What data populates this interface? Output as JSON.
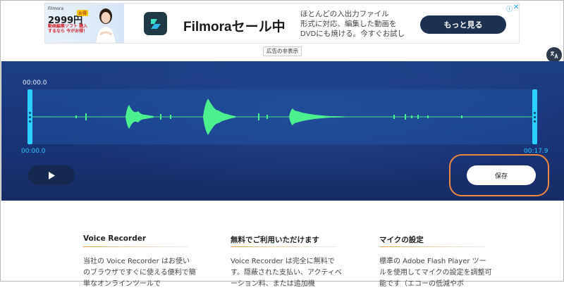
{
  "ad": {
    "thumb": {
      "brand": "Filmora",
      "price": "2999円",
      "tag": "お得",
      "copy": "動画編集ソフト 購入するなら 今がお得！"
    },
    "title": "Filmoraセール中",
    "description_lines": [
      "ほとんどの入出力ファイル",
      "形式に対応、編集した動画を",
      "DVDにも焼ける。今すぐお試し"
    ],
    "cta": "もっと見る",
    "info_icon": "ⓘ",
    "close_icon": "✕",
    "hide_label": "広告の非表示"
  },
  "side": {
    "translate_icon": "translate-icon",
    "extension_icon": "extension-icon"
  },
  "recorder": {
    "time_current": "00:00.0",
    "time_start": "00:00.0",
    "time_end": "00:17.9",
    "play_icon": "play-icon",
    "save_label": "保存",
    "accent_color": "#2ad1ff",
    "highlight_color": "#f0873c"
  },
  "info": {
    "columns": [
      {
        "title": "Voice Recorder",
        "text": "当社の Voice Recorder はお使いのブラウザですぐに使える便利で簡単なオンラインツールで"
      },
      {
        "title": "無料でご利用いただけます",
        "text": "Voice Recorder は完全に無料です。隠蔽された支払い、アクティベーション料、または追加機"
      },
      {
        "title": "マイクの設定",
        "text": "標準の Adobe Flash Player ツールを使用してマイクの設定を調整可能です（エコーの低減やボ"
      }
    ]
  }
}
